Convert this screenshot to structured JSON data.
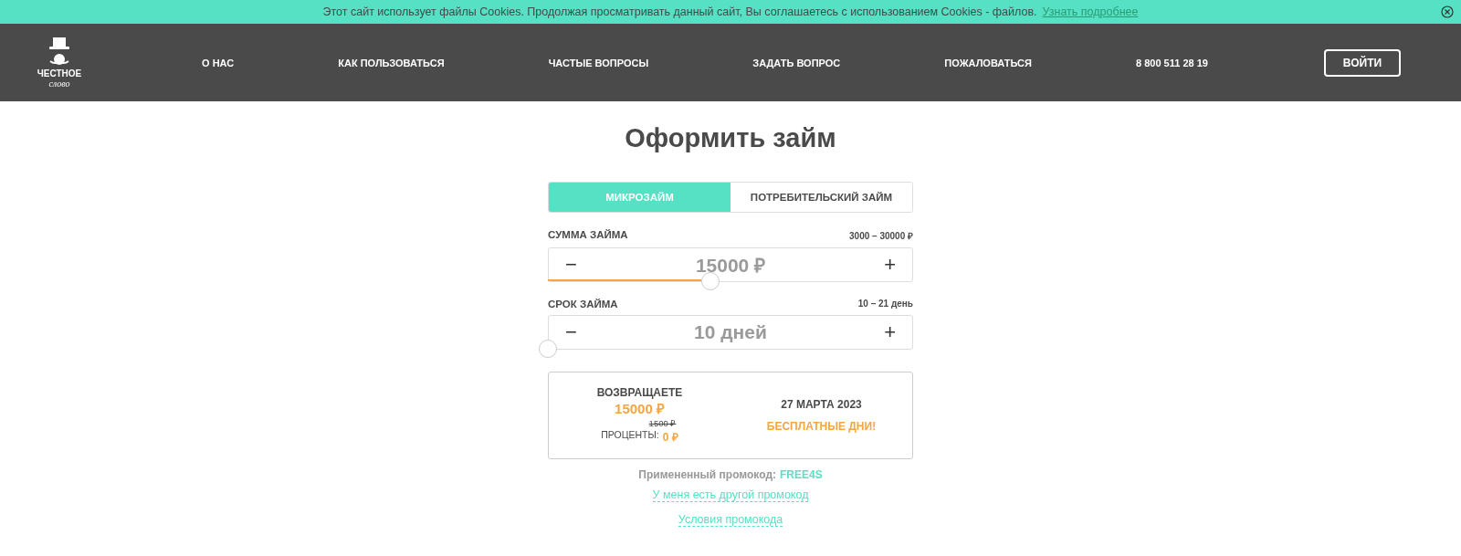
{
  "cookie_bar": {
    "text": "Этот сайт использует файлы Cookies. Продолжая просматривать данный сайт, Вы соглашаетесь с использованием Cookies - файлов.",
    "link": "Узнать подробнее"
  },
  "header": {
    "logo": {
      "line_1": "ЧЕСТНОЕ",
      "line_2": "слово"
    },
    "nav": [
      "О НАС",
      "КАК ПОЛЬЗОВАТЬСЯ",
      "ЧАСТЫЕ ВОПРОСЫ",
      "ЗАДАТЬ ВОПРОС",
      "ПОЖАЛОВАТЬСЯ"
    ],
    "phone": "8 800 511 28 19",
    "login_button": "ВОЙТИ"
  },
  "title": "Оформить займ",
  "tabs": [
    {
      "label": "МИКРОЗАЙМ",
      "selected": true
    },
    {
      "label": "ПОТРЕБИТЕЛЬСКИЙ ЗАЙМ",
      "selected": false
    }
  ],
  "sliders": [
    {
      "label": "СУММА ЗАЙМА",
      "range": "3000 – 30000 ₽",
      "minus": "−",
      "value": "15000 ₽",
      "plus": "+",
      "level": 0.444
    },
    {
      "label": "СРОК ЗАЙМА",
      "range": "10 – 21 день",
      "minus": "−",
      "value": "10 дней",
      "plus": "+",
      "level": 0
    }
  ],
  "summary": {
    "return_label": "ВОЗВРАЩАЕТЕ",
    "return_amount": "15000 ₽",
    "old_interest": "1500 ₽",
    "interest_label": "ПРОЦЕНТЫ:",
    "interest_value": "0 ₽",
    "date": "27 МАРТА 2023",
    "free_days": "БЕСПЛАТНЫЕ ДНИ!"
  },
  "promo": {
    "label": "Примененный промокод:",
    "code": "FREE4S",
    "other_link": "У меня есть другой промокод",
    "terms_link": "Условия промокода"
  }
}
